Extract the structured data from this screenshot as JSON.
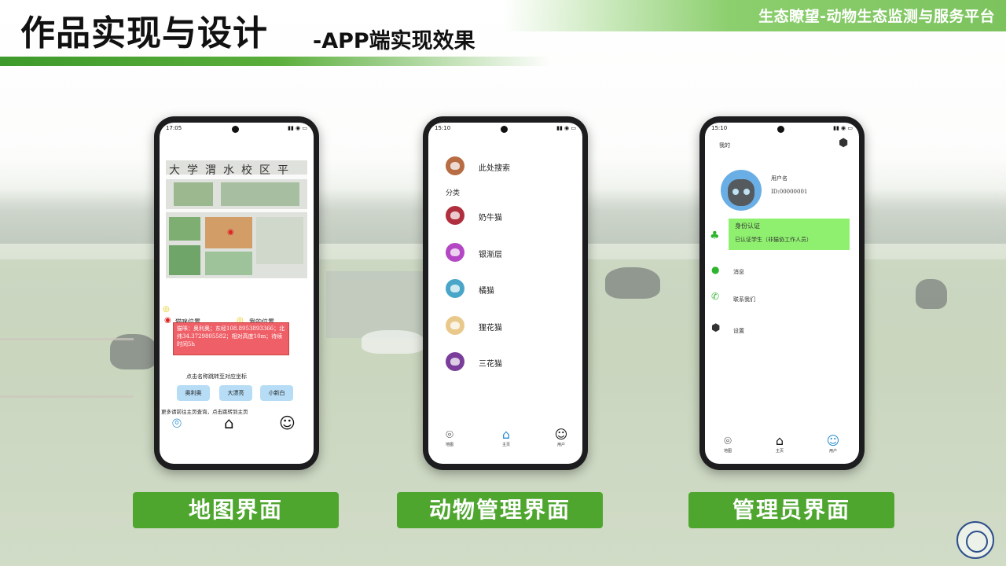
{
  "header": {
    "title_main": "作品实现与设计",
    "title_sub": "-APP端实现效果",
    "platform": "生态瞭望-动物生态监测与服务平台"
  },
  "labels": {
    "map": "地图界面",
    "animal": "动物管理界面",
    "admin": "管理员界面"
  },
  "phone_map": {
    "time": "17:05",
    "map_title": "大学渭水校区平",
    "legend_cat": "猫咪位置",
    "legend_me": "我的位置",
    "info_text": "猫咪：奥利奥；东经108.8953893366；北纬34.3729805582；相对高度10m；待续时间5h",
    "hint": "点击名称跳转至对应坐标",
    "pills": [
      "奥利奥",
      "大漂亮",
      "小新白"
    ],
    "more": "更多请前往主页查询，点击跳转到主页"
  },
  "phone_animal": {
    "time": "15:10",
    "search": "此处搜索",
    "category": "分类",
    "cats": [
      {
        "label": "奶牛猫",
        "color": "#b02f3e"
      },
      {
        "label": "银渐层",
        "color": "#b347c4"
      },
      {
        "label": "橘猫",
        "color": "#4aa6c8"
      },
      {
        "label": "狸花猫",
        "color": "#e9c98b"
      },
      {
        "label": "三花猫",
        "color": "#7a3d9a"
      }
    ],
    "search_avatar_color": "#b86c43",
    "nav": [
      "地图",
      "主页",
      "用户"
    ]
  },
  "phone_admin": {
    "time": "15:10",
    "title": "我的",
    "username": "用户名",
    "id": "ID:00000001",
    "auth_title": "身份认证",
    "auth_desc": "已认证学生（非猫协工作人员）",
    "message": "消息",
    "contact": "联系我们",
    "settings": "设置",
    "nav": [
      "地图",
      "主页",
      "用户"
    ]
  }
}
